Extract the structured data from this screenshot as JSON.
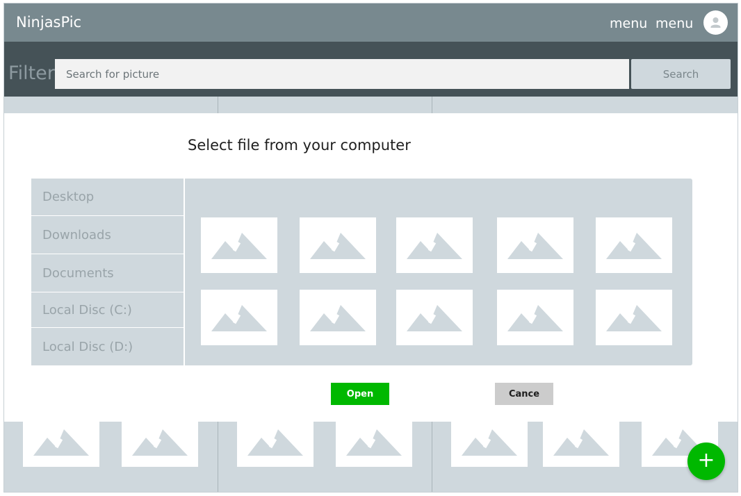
{
  "header": {
    "brand": "NinjasPic",
    "menu_1": "menu",
    "menu_2": "menu",
    "avatar_icon": "user-avatar-icon",
    "color": "#78898f"
  },
  "filterbar": {
    "label": "Filter",
    "search_placeholder": "Search for picture",
    "search_button": "Search",
    "color": "#455257"
  },
  "dialog": {
    "title": "Select file from your computer",
    "folders": [
      {
        "label": "Desktop"
      },
      {
        "label": "Downloads"
      },
      {
        "label": "Documents"
      },
      {
        "label": "Local Disc (C:)"
      },
      {
        "label": "Local Disc (D:)"
      }
    ],
    "thumbnail_icon": "image-placeholder-icon",
    "thumbnail_count": 10,
    "open_label": "Open",
    "cancel_label": "Cance",
    "open_color": "#00b800",
    "cancel_color": "#cccccc"
  },
  "gallery": {
    "tile_icon": "image-placeholder-icon",
    "background": "#cfd8dd"
  },
  "fab": {
    "label": "+",
    "icon": "plus-icon",
    "color": "#00b800"
  }
}
